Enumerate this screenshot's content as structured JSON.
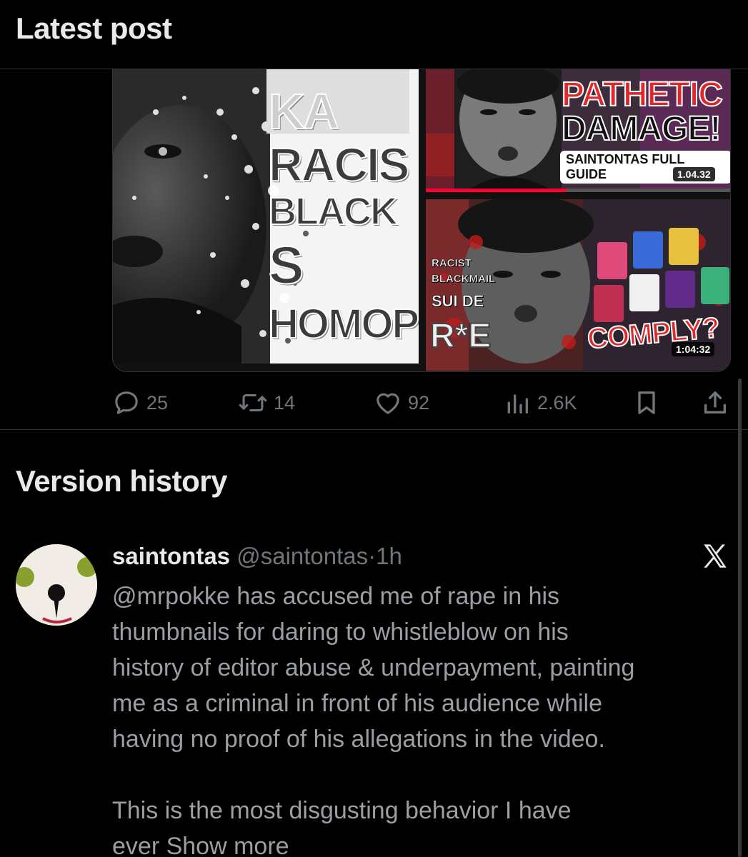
{
  "header": {
    "title": "Latest post"
  },
  "media": {
    "left": {
      "lines": [
        "RACIS",
        "BLACK",
        "S",
        "HOMOP"
      ]
    },
    "top_right": {
      "headline_1": "PATHETIC",
      "headline_2": "DAMAGE!",
      "subtitle": "SAINTONTAS FULL GUIDE",
      "duration": "1.04.32",
      "progress_fraction": 0.46
    },
    "bottom_right": {
      "tags": [
        "RACIST",
        "BLACKMAIL",
        "SUI DE"
      ],
      "big_word": "R*E",
      "headline": "COMPLY?",
      "duration": "1:04:32"
    }
  },
  "actions": {
    "replies": "25",
    "reposts": "14",
    "likes": "92",
    "views": "2.6K"
  },
  "version_history": {
    "title": "Version history",
    "post": {
      "name": "saintontas",
      "handle": "@saintontas",
      "separator": "·",
      "time": "1h",
      "lines_p1": [
        "@mrpokke has accused me of rape in his",
        "thumbnails for daring to whistleblow on his",
        "history of editor abuse & underpayment, painting",
        "me as a criminal in front of his audience while",
        "having no proof of his allegations in the video."
      ],
      "line_p2_1": "This is the most disgusting behavior I have",
      "line_p2_2": "ever",
      "show_more": "Show more"
    }
  },
  "colors": {
    "background": "#000000",
    "text_primary": "#e7e9ea",
    "text_secondary": "#71767b",
    "divider": "#2f3336",
    "thumb_red": "#e0282a"
  },
  "icons": {
    "reply": "reply-bubble-icon",
    "repost": "repost-arrows-icon",
    "like": "heart-icon",
    "views": "bar-chart-icon",
    "bookmark": "bookmark-icon",
    "share": "share-upload-icon",
    "x_logo": "x-logo-icon"
  }
}
